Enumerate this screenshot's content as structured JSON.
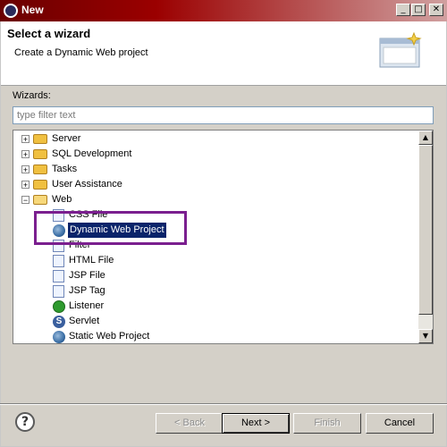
{
  "window": {
    "title": "New"
  },
  "header": {
    "title": "Select a wizard",
    "subtitle": "Create a Dynamic Web project"
  },
  "wizards": {
    "label": "Wizards:",
    "filter_placeholder": "type filter text",
    "tree": [
      {
        "label": "Server",
        "type": "folder",
        "expanded": false
      },
      {
        "label": "SQL Development",
        "type": "folder",
        "expanded": false
      },
      {
        "label": "Tasks",
        "type": "folder",
        "expanded": false
      },
      {
        "label": "User Assistance",
        "type": "folder",
        "expanded": false
      },
      {
        "label": "Web",
        "type": "folder",
        "expanded": true
      },
      {
        "label": "CSS File",
        "type": "file"
      },
      {
        "label": "Dynamic Web Project",
        "type": "globe",
        "selected": true
      },
      {
        "label": "Filter",
        "type": "file"
      },
      {
        "label": "HTML File",
        "type": "file"
      },
      {
        "label": "JSP File",
        "type": "file"
      },
      {
        "label": "JSP Tag",
        "type": "file"
      },
      {
        "label": "Listener",
        "type": "listener"
      },
      {
        "label": "Servlet",
        "type": "servlet"
      },
      {
        "label": "Static Web Project",
        "type": "globe"
      }
    ]
  },
  "buttons": {
    "back": "< Back",
    "next": "Next >",
    "finish": "Finish",
    "cancel": "Cancel",
    "help": "?"
  },
  "colors": {
    "selection": "#0a246a",
    "highlight_box": "#7b1f8f",
    "titlebar": "#9b0000"
  }
}
